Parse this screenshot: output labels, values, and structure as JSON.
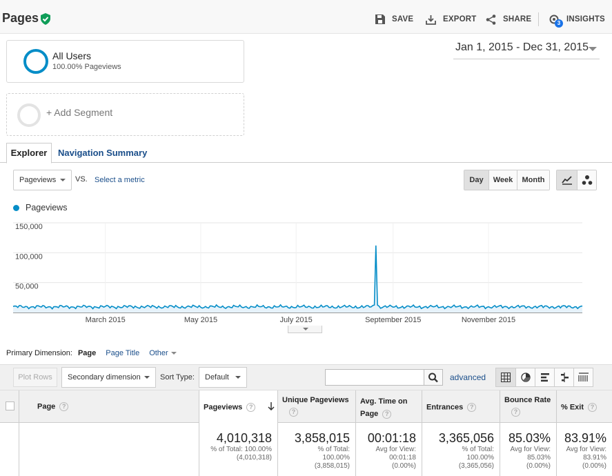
{
  "header": {
    "title": "Pages",
    "actions": [
      {
        "label": "SAVE",
        "icon": "save-icon"
      },
      {
        "label": "EXPORT",
        "icon": "export-icon"
      },
      {
        "label": "SHARE",
        "icon": "share-icon"
      },
      {
        "label": "INSIGHTS",
        "icon": "insights-icon",
        "badge": "3"
      }
    ]
  },
  "segments": {
    "active": {
      "name": "All Users",
      "sub": "100.00% Pageviews"
    },
    "add_label": "+ Add Segment"
  },
  "date_range": "Jan 1, 2015 - Dec 31, 2015",
  "tabs": [
    {
      "label": "Explorer",
      "active": true
    },
    {
      "label": "Navigation Summary",
      "active": false
    }
  ],
  "metric": {
    "selected": "Pageviews",
    "vs_label": "VS.",
    "select_metric": "Select a metric"
  },
  "granularity": [
    {
      "label": "Day",
      "active": true
    },
    {
      "label": "Week",
      "active": false
    },
    {
      "label": "Month",
      "active": false
    }
  ],
  "chart_data": {
    "type": "line",
    "series": [
      {
        "name": "Pageviews",
        "color": "#058dc7"
      }
    ],
    "ylim": [
      0,
      150000
    ],
    "yticks": [
      {
        "value": 50000,
        "label": "50,000"
      },
      {
        "value": 100000,
        "label": "100,000"
      },
      {
        "value": 150000,
        "label": "150,000"
      }
    ],
    "xticks": [
      "March 2015",
      "May 2015",
      "July 2015",
      "September 2015",
      "November 2015"
    ],
    "x_range": [
      "2015-01-01",
      "2015-12-31"
    ],
    "baseline": 9500,
    "spike": {
      "date": "2015-08-21",
      "value": 112000
    },
    "grid": true
  },
  "primary_dimension": {
    "label": "Primary Dimension:",
    "current": "Page",
    "options": [
      "Page Title",
      "Other"
    ]
  },
  "toolbar": {
    "plot_rows": "Plot Rows",
    "secondary_dimension": "Secondary dimension",
    "sort_label": "Sort Type:",
    "sort_value": "Default",
    "search_placeholder": "",
    "advanced": "advanced"
  },
  "table": {
    "page_header": "Page",
    "columns": [
      {
        "label": "Pageviews",
        "value": "4,010,318",
        "sub1": "% of Total: 100.00%",
        "sub2": "(4,010,318)",
        "sub3": ""
      },
      {
        "label": "Unique Pageviews",
        "value": "3,858,015",
        "sub1": "% of Total:",
        "sub2": "100.00%",
        "sub3": "(3,858,015)"
      },
      {
        "label": "Avg. Time on Page",
        "value": "00:01:18",
        "sub1": "Avg for View:",
        "sub2": "00:01:18",
        "sub3": "(0.00%)"
      },
      {
        "label": "Entrances",
        "value": "3,365,056",
        "sub1": "% of Total:",
        "sub2": "100.00%",
        "sub3": "(3,365,056)"
      },
      {
        "label": "Bounce Rate",
        "value": "85.03%",
        "sub1": "Avg for View:",
        "sub2": "85.03%",
        "sub3": "(0.00%)"
      },
      {
        "label": "% Exit",
        "value": "83.91%",
        "sub1": "Avg for View:",
        "sub2": "83.91%",
        "sub3": "(0.00%)"
      }
    ]
  }
}
